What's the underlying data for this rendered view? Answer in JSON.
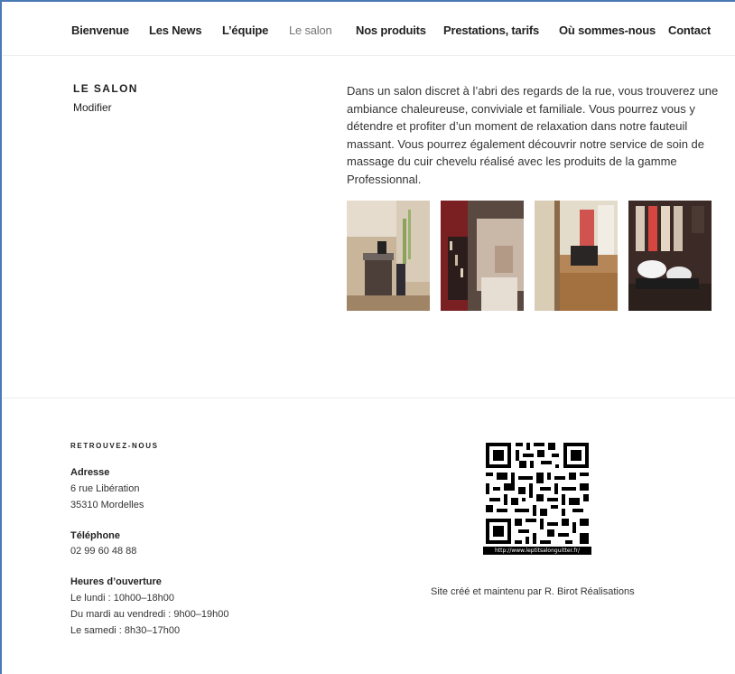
{
  "nav": {
    "items": [
      {
        "label": "Bienvenue"
      },
      {
        "label": "Les News"
      },
      {
        "label": "L’équipe"
      },
      {
        "label": "Le salon"
      },
      {
        "label": "Nos produits"
      },
      {
        "label": "Prestations, tarifs"
      },
      {
        "label": "Où sommes-nous"
      },
      {
        "label": "Contact"
      }
    ],
    "current": "Le salon"
  },
  "main": {
    "title": "LE SALON",
    "edit_link": "Modifier",
    "paragraph": "Dans un salon discret à l’abri des regards de la rue, vous trouverez une ambiance chaleureuse, conviviale et familiale. Vous pourrez vous y détendre et profiter d’un moment de relaxation dans notre fauteuil massant. Vous pourrez également découvrir notre service de soin de massage du cuir chevelu réalisé avec les produits de la gamme Professionnal.",
    "gallery_count": 4
  },
  "footer": {
    "widget_title": "RETROUVEZ-NOUS",
    "address_label": "Adresse",
    "address_line1": "6 rue Libération",
    "address_line2": "35310 Mordelles",
    "phone_label": "Téléphone",
    "phone": "02 99 60 48 88",
    "hours_label": "Heures d’ouverture",
    "hours_line1": "Le lundi : 10h00–18h00",
    "hours_line2": "Du mardi au vendredi : 9h00–19h00",
    "hours_line3": "Le samedi : 8h30–17h00",
    "qr_caption": "http://www.leptitsalonguitter.fr/",
    "credits": "Site créé et maintenu par R. Birot Réalisations"
  }
}
